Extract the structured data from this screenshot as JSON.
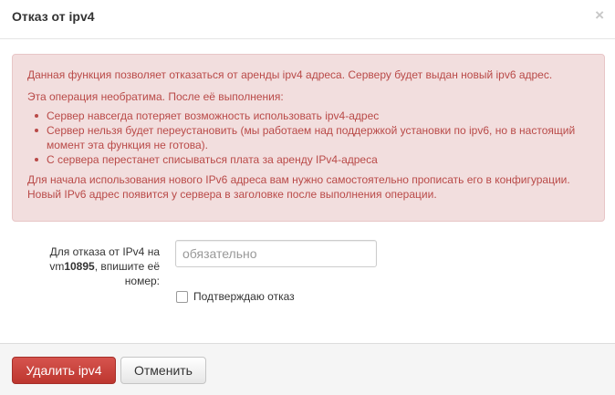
{
  "dialog": {
    "title": "Отказ от ipv4",
    "close_icon": "close-icon",
    "close_glyph": "×"
  },
  "alert": {
    "paragraph1": "Данная функция позволяет отказаться от аренды ipv4 адреса. Серверу будет выдан новый ipv6 адрес.",
    "paragraph2": "Эта операция необратима. После её выполнения:",
    "bullets": [
      "Сервер навсегда потеряет возможность использовать ipv4-адрес",
      "Сервер нельзя будет переустановить (мы работаем над поддержкой установки по ipv6, но в настоящий момент эта функция не готова).",
      "С сервера перестанет списываться плата за аренду IPv4-адреса"
    ],
    "paragraph3": "Для начала использования нового IPv6 адреса вам нужно самостоятельно прописать его в конфигурации. Новый IPv6 адрес появится у сервера в заголовке после выполнения операции.",
    "color": "#b94a48",
    "background": "#f2dede"
  },
  "form": {
    "label_prefix": "Для отказа от IPv4 на vm",
    "vm_number": "10895",
    "label_suffix": ", впишите её номер:",
    "input_placeholder": "обязательно",
    "input_value": "",
    "checkbox_label": "Подтверждаю отказ",
    "checkbox_checked": false
  },
  "footer": {
    "delete_label": "Удалить ipv4",
    "cancel_label": "Отменить",
    "danger_color": "#da4f49"
  }
}
